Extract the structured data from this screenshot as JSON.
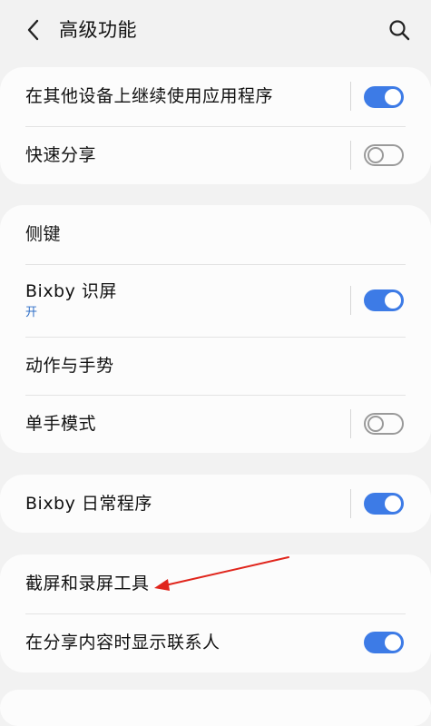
{
  "header": {
    "title": "高级功能"
  },
  "groups": [
    {
      "items": [
        {
          "label": "在其他设备上继续使用应用程序",
          "toggle": "on"
        },
        {
          "label": "快速分享",
          "toggle": "off"
        }
      ]
    },
    {
      "items": [
        {
          "label": "侧键"
        },
        {
          "label": "Bixby 识屏",
          "sub": "开",
          "toggle": "on"
        },
        {
          "label": "动作与手势"
        },
        {
          "label": "单手模式",
          "toggle": "off"
        }
      ]
    },
    {
      "items": [
        {
          "label": "Bixby 日常程序",
          "toggle": "on"
        }
      ]
    },
    {
      "items": [
        {
          "label": "截屏和录屏工具"
        },
        {
          "label": "在分享内容时显示联系人",
          "toggle": "on"
        }
      ]
    }
  ],
  "colors": {
    "accent": "#3d7be6",
    "annotation_arrow": "#e0251c",
    "background": "#f2f2f2",
    "card": "#fcfcfc"
  },
  "icons": {
    "back": "chevron-left-icon",
    "search": "search-icon"
  }
}
